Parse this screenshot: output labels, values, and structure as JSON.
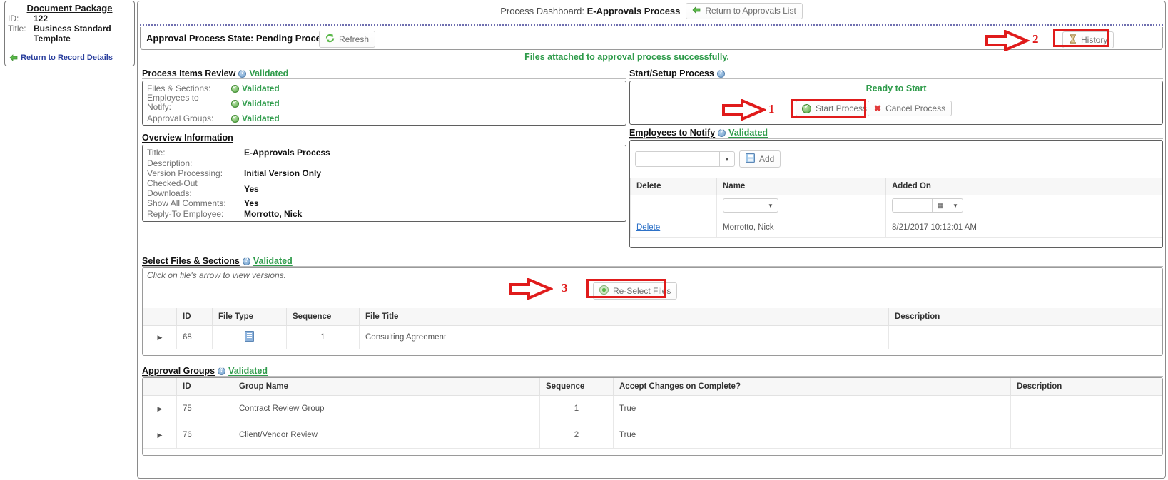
{
  "left_card": {
    "heading": "Document Package",
    "id_label": "ID:",
    "id_value": "122",
    "title_label": "Title:",
    "title_value": "Business Standard Template",
    "return_link": "Return to Record Details"
  },
  "header": {
    "dashboard_label": "Process Dashboard:",
    "dashboard_value": "E-Approvals Process",
    "return_button": "Return to Approvals List",
    "state_label": "Approval Process State: Pending Process",
    "refresh_button": "Refresh",
    "history_button": "History",
    "success_message": "Files attached to approval process successfully."
  },
  "process_items_review": {
    "heading": "Process Items Review",
    "status": "Validated",
    "rows": [
      {
        "label": "Files & Sections:",
        "status": "Validated"
      },
      {
        "label": "Employees to Notify:",
        "status": "Validated"
      },
      {
        "label": "Approval Groups:",
        "status": "Validated"
      }
    ]
  },
  "overview_information": {
    "heading": "Overview Information",
    "rows": [
      {
        "label": "Title:",
        "value": "E-Approvals Process"
      },
      {
        "label": "Description:",
        "value": ""
      },
      {
        "label": "Version Processing:",
        "value": "Initial Version Only"
      },
      {
        "label": "Checked-Out Downloads:",
        "value": "Yes"
      },
      {
        "label": "Show All Comments:",
        "value": "Yes"
      },
      {
        "label": "Reply-To Employee:",
        "value": "Morrotto, Nick"
      }
    ]
  },
  "start_setup_process": {
    "heading": "Start/Setup Process",
    "ready_text": "Ready to Start",
    "start_button": "Start Process",
    "cancel_button": "Cancel Process"
  },
  "employees_to_notify": {
    "heading": "Employees to Notify",
    "status": "Validated",
    "dropdown_value": "",
    "add_button": "Add",
    "columns": [
      "Delete",
      "Name",
      "Added On"
    ],
    "rows": [
      {
        "delete": "Delete",
        "name": "Morrotto, Nick",
        "added_on": "8/21/2017 10:12:01 AM"
      }
    ]
  },
  "select_files_sections": {
    "heading": "Select Files & Sections",
    "status": "Validated",
    "hint": "Click on file's arrow to view versions.",
    "reselect_button": "Re-Select Files",
    "columns": [
      "",
      "ID",
      "File Type",
      "Sequence",
      "File Title",
      "Description"
    ],
    "rows": [
      {
        "id": "68",
        "file_type_icon": "document-icon",
        "sequence": "1",
        "file_title": "Consulting Agreement",
        "description": ""
      }
    ]
  },
  "approval_groups": {
    "heading": "Approval Groups",
    "status": "Validated",
    "columns": [
      "",
      "ID",
      "Group Name",
      "Sequence",
      "Accept Changes on Complete?",
      "Description"
    ],
    "rows": [
      {
        "id": "75",
        "group_name": "Contract Review Group",
        "sequence": "1",
        "accept_changes": "True",
        "description": ""
      },
      {
        "id": "76",
        "group_name": "Client/Vendor Review",
        "sequence": "2",
        "accept_changes": "True",
        "description": ""
      }
    ]
  },
  "annotations": {
    "one": "1",
    "two": "2",
    "three": "3",
    "color": "#e01b1b"
  }
}
